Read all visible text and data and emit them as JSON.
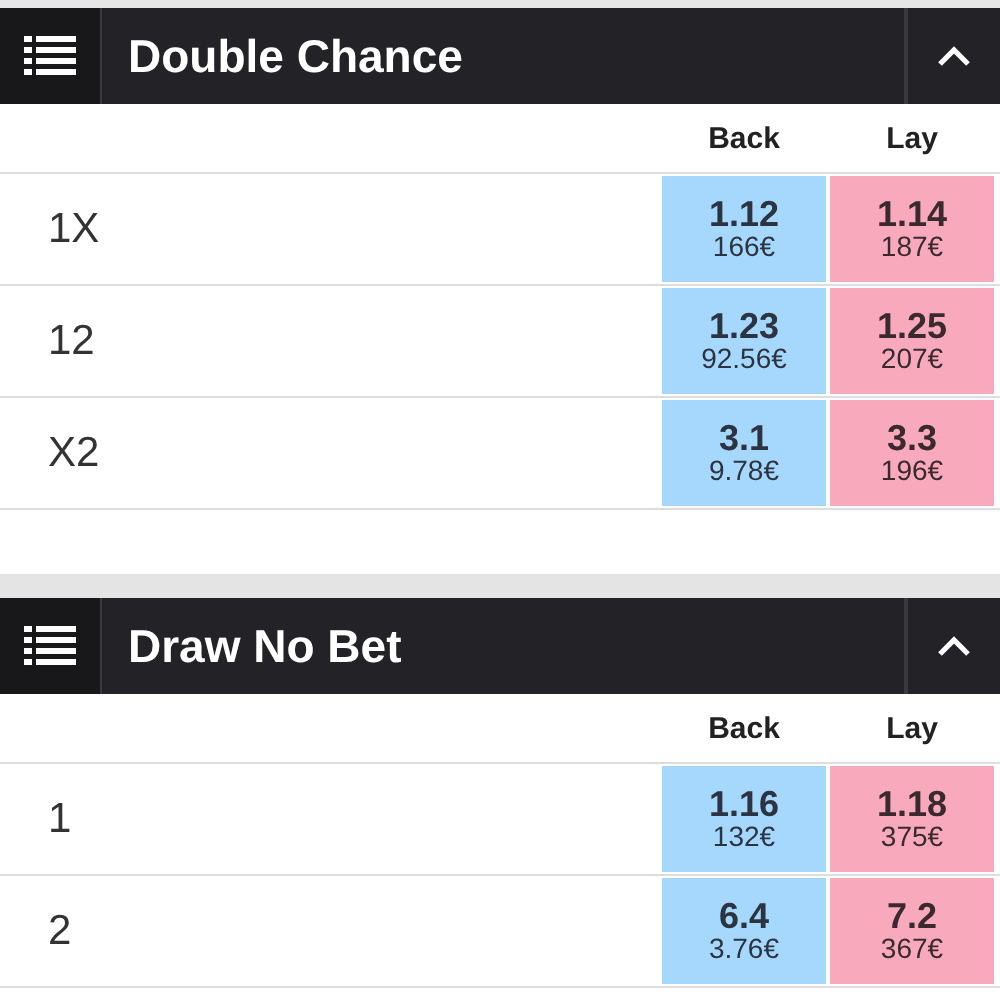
{
  "markets": [
    {
      "title": "Double Chance",
      "expanded": true,
      "columns": [
        "Back",
        "Lay"
      ],
      "rows": [
        {
          "label": "1X",
          "back": {
            "price": "1.12",
            "amount": "166€"
          },
          "lay": {
            "price": "1.14",
            "amount": "187€"
          }
        },
        {
          "label": "12",
          "back": {
            "price": "1.23",
            "amount": "92.56€"
          },
          "lay": {
            "price": "1.25",
            "amount": "207€"
          }
        },
        {
          "label": "X2",
          "back": {
            "price": "3.1",
            "amount": "9.78€"
          },
          "lay": {
            "price": "3.3",
            "amount": "196€"
          }
        }
      ]
    },
    {
      "title": "Draw No Bet",
      "expanded": true,
      "columns": [
        "Back",
        "Lay"
      ],
      "rows": [
        {
          "label": "1",
          "back": {
            "price": "1.16",
            "amount": "132€"
          },
          "lay": {
            "price": "1.18",
            "amount": "375€"
          }
        },
        {
          "label": "2",
          "back": {
            "price": "6.4",
            "amount": "3.76€"
          },
          "lay": {
            "price": "7.2",
            "amount": "367€"
          }
        }
      ]
    }
  ]
}
